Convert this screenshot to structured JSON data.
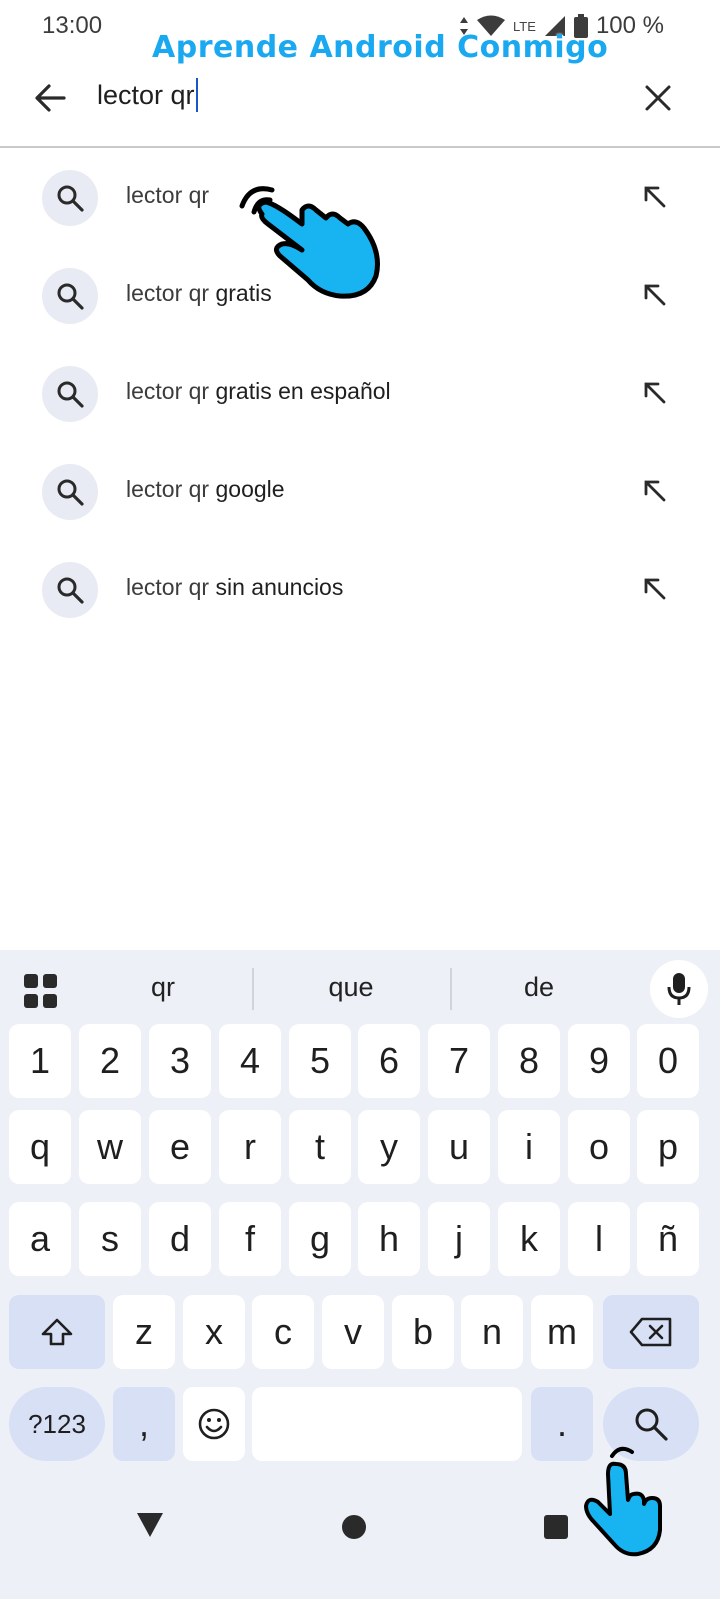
{
  "status_bar": {
    "time": "13:00",
    "network": "LTE",
    "battery": "100 %"
  },
  "watermark": "Aprende Android Conmigo",
  "search": {
    "query": "lector qr"
  },
  "suggestions": [
    {
      "prefix": "lector qr",
      "suffix": ""
    },
    {
      "prefix": "lector qr",
      "suffix": " gratis"
    },
    {
      "prefix": "lector qr",
      "suffix": " gratis en español"
    },
    {
      "prefix": "lector qr",
      "suffix": " google"
    },
    {
      "prefix": "lector qr",
      "suffix": " sin anuncios"
    }
  ],
  "keyboard": {
    "suggestions": [
      "qr",
      "que",
      "de"
    ],
    "row_numbers": [
      "1",
      "2",
      "3",
      "4",
      "5",
      "6",
      "7",
      "8",
      "9",
      "0"
    ],
    "row_top": [
      "q",
      "w",
      "e",
      "r",
      "t",
      "y",
      "u",
      "i",
      "o",
      "p"
    ],
    "row_middle": [
      "a",
      "s",
      "d",
      "f",
      "g",
      "h",
      "j",
      "k",
      "l",
      "ñ"
    ],
    "row_bottom": [
      "z",
      "x",
      "c",
      "v",
      "b",
      "n",
      "m"
    ],
    "symbols_label": "?123",
    "comma_label": ",",
    "period_label": "."
  },
  "icons": {
    "back": "arrow-left-icon",
    "clear": "close-icon",
    "suggestion": "search-icon",
    "fill": "arrow-up-left-icon",
    "apps": "grid-icon",
    "mic": "mic-icon",
    "shift": "shift-icon",
    "backspace": "backspace-icon",
    "emoji": "emoji-icon",
    "search_action": "search-icon"
  },
  "colors": {
    "watermark": "#1aa9f0",
    "caret": "#1a56c9",
    "keyboard_bg": "#eef0f7",
    "mod_key": "#d8e0f5",
    "hand": "#18b4f2"
  }
}
